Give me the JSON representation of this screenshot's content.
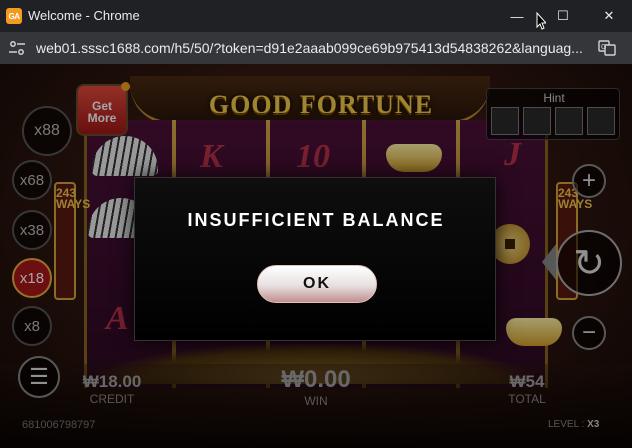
{
  "window": {
    "app_icon_text": "GA",
    "title": "Welcome - Chrome",
    "minimize_glyph": "—",
    "maximize_glyph": "☐",
    "close_glyph": "✕"
  },
  "address_bar": {
    "url": "web01.sssc1688.com/h5/50/?token=d91e2aaab099ce69b975413d54838262&languag..."
  },
  "game": {
    "logo_text": "GOOD FORTUNE",
    "ways_text": "243 WAYS",
    "get_more_label": "Get More",
    "hint_label": "Hint",
    "multipliers": [
      {
        "label": "x88",
        "active": false
      },
      {
        "label": "x68",
        "active": false
      },
      {
        "label": "x38",
        "active": false
      },
      {
        "label": "x18",
        "active": true
      },
      {
        "label": "x8",
        "active": false
      }
    ],
    "reel_symbols": [
      "K",
      "10",
      "J",
      "A"
    ],
    "credit": {
      "value": "₩18.00",
      "label": "CREDIT"
    },
    "win": {
      "value": "₩0.00",
      "label": "WIN"
    },
    "total": {
      "value": "₩54",
      "label": "TOTAL"
    },
    "player_id": "681006798797",
    "level": {
      "label": "LEVEL :",
      "value": "X3"
    },
    "buttons": {
      "plus": "+",
      "minus": "−",
      "spin": "↻",
      "menu": "☰"
    }
  },
  "dialog": {
    "message": "INSUFFICIENT BALANCE",
    "ok_label": "OK"
  },
  "colors": {
    "accent_gold": "#f6cc4a",
    "active_multiplier": "#a8161a",
    "dialog_bg": "#000000"
  }
}
